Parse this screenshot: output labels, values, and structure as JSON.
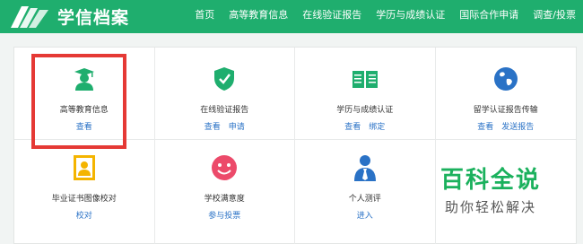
{
  "header": {
    "logo_text": "学信档案",
    "nav": [
      "首页",
      "高等教育信息",
      "在线验证报告",
      "学历与成绩认证",
      "国际合作申请",
      "调查/投票"
    ]
  },
  "colors": {
    "header_green": "#1fae6e",
    "link_blue": "#2a72c6",
    "highlight_red": "#e53935"
  },
  "tiles": [
    {
      "label": "高等教育信息",
      "icon": "graduate-icon",
      "links": [
        "查看"
      ]
    },
    {
      "label": "在线验证报告",
      "icon": "shield-check-icon",
      "links": [
        "查看",
        "申请"
      ]
    },
    {
      "label": "学历与成绩认证",
      "icon": "open-book-icon",
      "links": [
        "查看",
        "绑定"
      ]
    },
    {
      "label": "留学认证报告传输",
      "icon": "globe-icon",
      "links": [
        "查看",
        "发送报告"
      ]
    },
    {
      "label": "毕业证书图像校对",
      "icon": "id-photo-icon",
      "links": [
        "校对"
      ]
    },
    {
      "label": "学校满意度",
      "icon": "smiley-icon",
      "links": [
        "参与投票"
      ]
    },
    {
      "label": "个人测评",
      "icon": "person-tie-icon",
      "links": [
        "进入"
      ]
    },
    {
      "label": "",
      "icon": "",
      "links": []
    }
  ],
  "watermark": {
    "main": "百科全说",
    "sub": "助你轻松解决"
  }
}
